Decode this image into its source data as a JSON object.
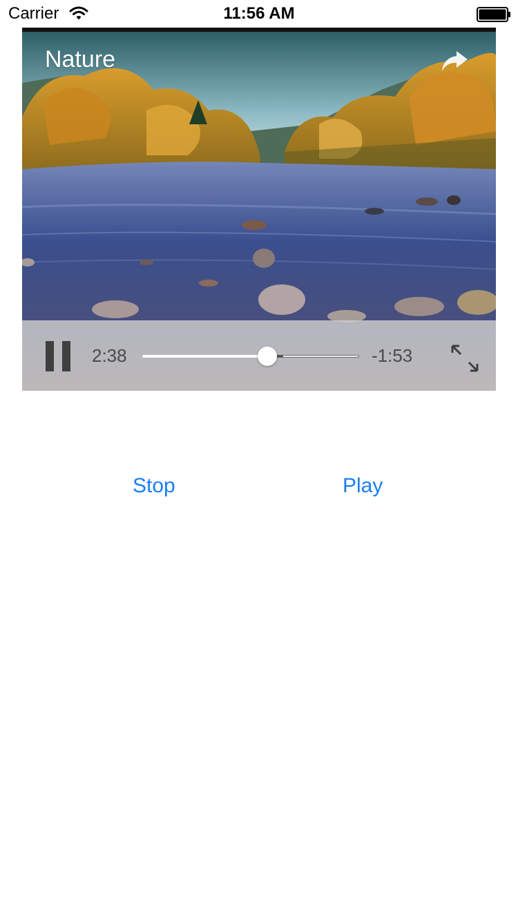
{
  "status_bar": {
    "carrier": "Carrier",
    "time": "11:56 AM",
    "icons": [
      "wifi-icon",
      "battery-icon"
    ]
  },
  "player": {
    "title": "Nature",
    "elapsed": "2:38",
    "remaining": "-1:53",
    "progress": 0.575,
    "buffered": 0.65,
    "icons": [
      "share-icon",
      "pause-icon",
      "fullscreen-icon"
    ]
  },
  "buttons": {
    "stop_label": "Stop",
    "play_label": "Play"
  },
  "colors": {
    "accent": "#1a7ef5",
    "controls_bg": "#cdcdcd"
  }
}
